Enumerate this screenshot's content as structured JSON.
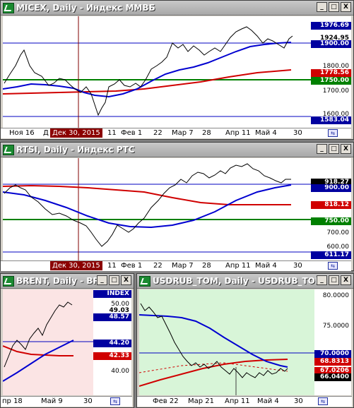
{
  "window_buttons": {
    "minimize": "_",
    "maximize": "□",
    "close": "X"
  },
  "micex": {
    "title": "MICEX, Daily - Индекс ММВБ",
    "ticks": [
      "1800.00",
      "1700.00",
      "1600.00"
    ],
    "labels": {
      "high": "1976.69",
      "price": "1924.95",
      "level1": "1900.00",
      "ma_red": "1778.56",
      "level2": "1750.00",
      "low": "1583.04"
    },
    "dates": [
      "Ноя 16",
      "Д",
      "11",
      "Фев 1",
      "22",
      "Мар 7",
      "28",
      "Апр 11",
      "Май 4",
      "30"
    ],
    "cursor_date": "Дек 30, 2015"
  },
  "rtsi": {
    "title": "RTSI, Daily - Индекс РТС",
    "ticks": [
      "700.00",
      "600.00"
    ],
    "labels": {
      "price": "918.27",
      "level1": "900.00",
      "ma_red": "818.12",
      "level2": "750.00",
      "low": "611.17"
    },
    "dates": [
      "11",
      "Фев 1",
      "22",
      "Мар 7",
      "28",
      "Апр 11",
      "Май 4",
      "30"
    ],
    "cursor_date": "Дек 30, 2015"
  },
  "brent": {
    "title": "BRENT, Daily - BR...",
    "index_label": "INDEX",
    "ticks": [
      "50.00",
      "40.00"
    ],
    "labels": {
      "price": "49.03",
      "level_partial": "48.57",
      "ma_blue": "44.20",
      "ma_red": "42.33"
    },
    "dates": [
      "пр 18",
      "Май 9",
      "30"
    ]
  },
  "usdrub": {
    "title": "USDRUB_TOM, Daily - USDRUB_TOM",
    "ticks": [
      "80.0000",
      "75.0000"
    ],
    "labels": {
      "level1": "70.0000",
      "ma_red": "68.8313",
      "ma_blue": "67.0206",
      "price": "66.0400"
    },
    "dates": [
      "Фев 22",
      "Мар 21",
      "Апр 11",
      "Май 4",
      "30"
    ]
  }
}
